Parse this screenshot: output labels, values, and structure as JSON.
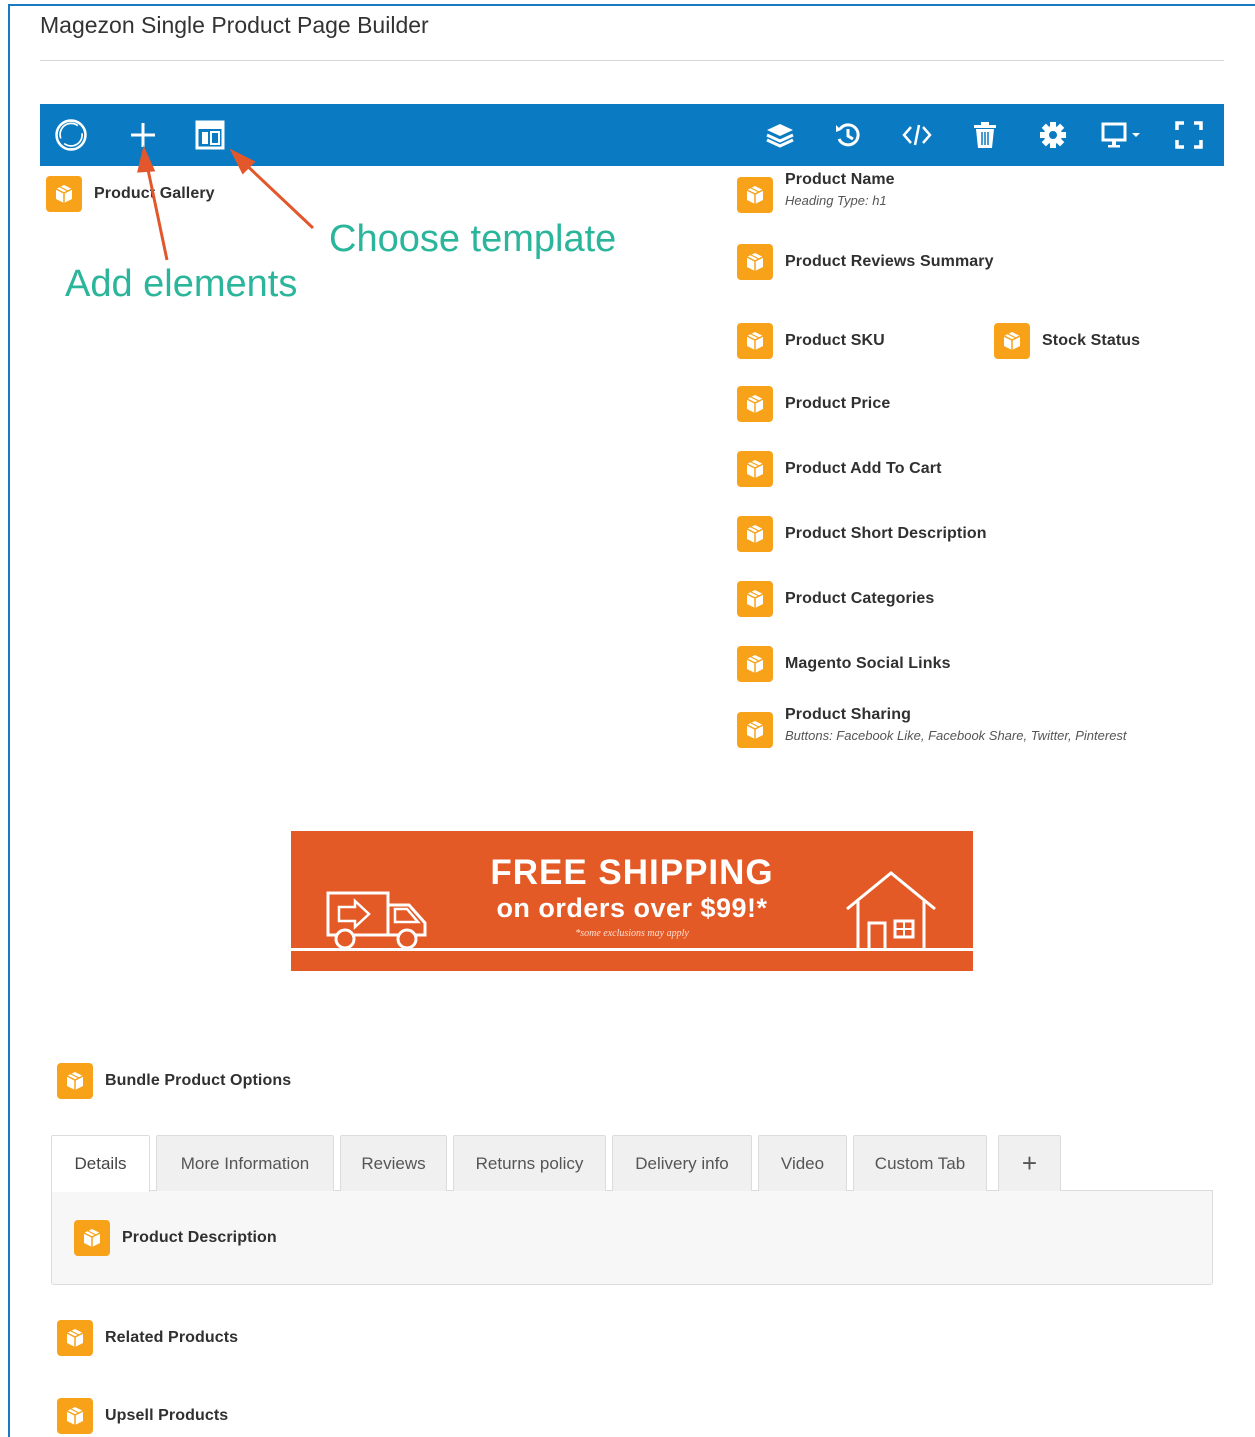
{
  "page": {
    "title": "Magezon Single Product Page Builder"
  },
  "colors": {
    "toolbar": "#0a7ac2",
    "element_badge": "#f8a21a",
    "annotation": "#2bb59a",
    "arrow": "#e2572b",
    "banner": "#e35a27"
  },
  "toolbar": {
    "left_icons": [
      "magezon-logo-icon",
      "plus-icon",
      "template-icon"
    ],
    "right_icons": [
      "layers-icon",
      "history-icon",
      "code-icon",
      "trash-icon",
      "gear-icon",
      "desktop-dropdown-icon",
      "fullscreen-icon"
    ]
  },
  "annotations": {
    "add_elements": "Add elements",
    "choose_template": "Choose template"
  },
  "elements": {
    "product_gallery": "Product Gallery",
    "product_name": {
      "name": "Product Name",
      "sub": "Heading Type: h1"
    },
    "product_reviews_summary": "Product Reviews Summary",
    "product_sku": "Product SKU",
    "stock_status": "Stock Status",
    "product_price": "Product Price",
    "product_add_to_cart": "Product Add To Cart",
    "product_short_description": "Product Short Description",
    "product_categories": "Product Categories",
    "magento_social_links": "Magento Social Links",
    "product_sharing": {
      "name": "Product Sharing",
      "sub": "Buttons: Facebook Like, Facebook Share, Twitter, Pinterest"
    },
    "bundle_product_options": "Bundle Product Options",
    "product_description": "Product Description",
    "related_products": "Related Products",
    "upsell_products": "Upsell Products"
  },
  "banner": {
    "headline": "FREE SHIPPING",
    "subline": "on orders over $99!*",
    "note": "*some exclusions may apply"
  },
  "tabs": {
    "items": [
      "Details",
      "More Information",
      "Reviews",
      "Returns policy",
      "Delivery info",
      "Video",
      "Custom Tab"
    ],
    "add_label": "+",
    "active": "Details"
  }
}
